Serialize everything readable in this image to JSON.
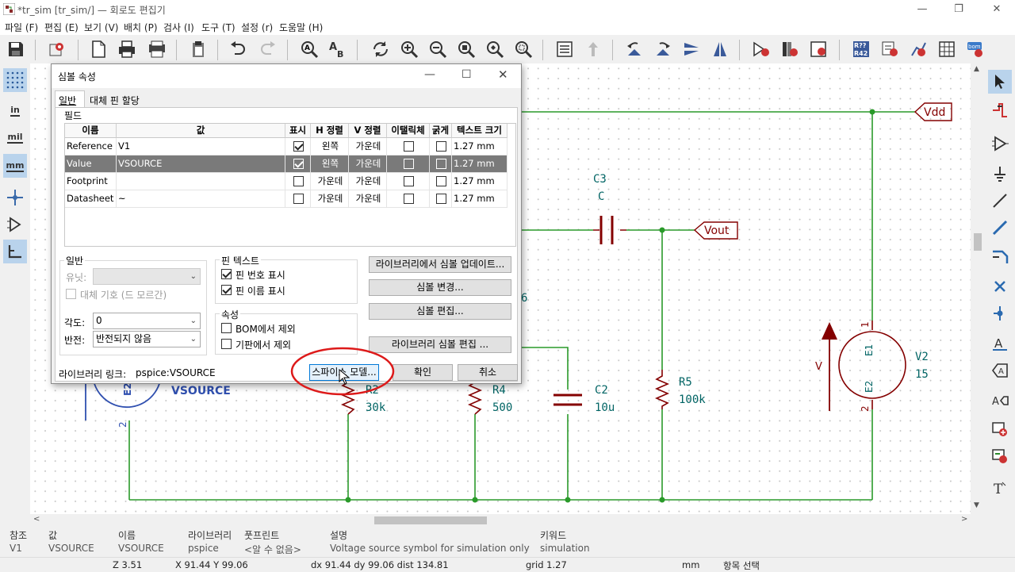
{
  "window": {
    "title": "*tr_sim [tr_sim/] — 회로도 편집기"
  },
  "menu": [
    "파일 (F)",
    "편집 (E)",
    "보기 (V)",
    "배치 (P)",
    "검사 (I)",
    "도구 (T)",
    "설정 (r)",
    "도움말 (H)"
  ],
  "left_toolbar": {
    "units_in": "in",
    "units_mil": "mil",
    "units_mm": "mm"
  },
  "schematic": {
    "labels": {
      "vdd": "Vdd",
      "vout": "Vout"
    },
    "c3": {
      "ref": "C3",
      "value": "C"
    },
    "c2": {
      "ref": "C2",
      "value": "10u"
    },
    "r5": {
      "ref": "R5",
      "value": "100k"
    },
    "r4": {
      "ref": "R4",
      "value": "500"
    },
    "r2": {
      "ref": "R2",
      "value": "30k"
    },
    "v2": {
      "ref": "V2",
      "value": "15",
      "pin_top": "E1",
      "pin_bottom": "E2",
      "pin_num_top": "1",
      "pin_num_bottom": "2",
      "arrow_label": "V"
    },
    "v1": {
      "value_text": "VSOURCE",
      "pin": "E2",
      "pin_num": "2"
    },
    "partial_text": "6"
  },
  "dialog": {
    "title": "심볼 속성",
    "tabs": [
      "일반",
      "대체 핀 할당"
    ],
    "fields_label": "필드",
    "columns": [
      "이름",
      "값",
      "표시",
      "H 정렬",
      "V 정렬",
      "이탤릭체",
      "굵게",
      "텍스트 크기"
    ],
    "rows": [
      {
        "name": "Reference",
        "value": "V1",
        "show": true,
        "h": "왼쪽",
        "v": "가운데",
        "italic": false,
        "bold": false,
        "size": "1.27 mm",
        "selected": false
      },
      {
        "name": "Value",
        "value": "VSOURCE",
        "show": true,
        "h": "왼쪽",
        "v": "가운데",
        "italic": false,
        "bold": false,
        "size": "1.27 mm",
        "selected": true
      },
      {
        "name": "Footprint",
        "value": "",
        "show": false,
        "h": "가운데",
        "v": "가운데",
        "italic": false,
        "bold": false,
        "size": "1.27 mm",
        "selected": false
      },
      {
        "name": "Datasheet",
        "value": "~",
        "show": false,
        "h": "가운데",
        "v": "가운데",
        "italic": false,
        "bold": false,
        "size": "1.27 mm",
        "selected": false
      }
    ],
    "general": {
      "label": "일반",
      "unit_label": "유닛:",
      "alt_symbol": "대체 기호 (드 모르간)",
      "angle_label": "각도:",
      "angle_value": "0",
      "mirror_label": "반전:",
      "mirror_value": "반전되지 않음"
    },
    "pin_text": {
      "label": "핀 텍스트",
      "show_pin_numbers": "핀 번호 표시",
      "show_pin_names": "핀 이름 표시"
    },
    "attributes": {
      "label": "속성",
      "exclude_bom": "BOM에서 제외",
      "exclude_board": "기판에서 제외"
    },
    "buttons": {
      "update_from_library": "라이브러리에서 심볼 업데이트...",
      "change_symbol": "심볼 변경...",
      "edit_symbol": "심볼 편집...",
      "edit_library_symbol": "라이브러리 심볼 편집 ...",
      "spice_model": "스파이스 모델...",
      "ok": "확인",
      "cancel": "취소"
    },
    "library_link_label": "라이브러리 링크:",
    "library_link_value": "pspice:VSOURCE"
  },
  "message_panel": [
    {
      "header": "참조",
      "value": "V1"
    },
    {
      "header": "값",
      "value": "VSOURCE"
    },
    {
      "header": "이름",
      "value": "VSOURCE"
    },
    {
      "header": "라이브러리",
      "value": "pspice"
    },
    {
      "header": "풋프린트",
      "value": "<알 수 없음>"
    },
    {
      "header": "설명",
      "value": "Voltage source symbol for simulation only"
    },
    {
      "header": "키워드",
      "value": "simulation"
    }
  ],
  "status": {
    "zoom": "Z 3.51",
    "xy": "X 91.44  Y 99.06",
    "delta": "dx 91.44  dy 99.06  dist 134.81",
    "grid": "grid 1.27",
    "units": "mm",
    "mode": "항목 선택"
  },
  "colors": {
    "wire": "#2a9a2a",
    "component": "#840000",
    "label_text": "#840000",
    "ref_text": "#006464",
    "selected_row": "#7a7a7a",
    "annotation_circle": "#dd1a1a",
    "vsource_text": "#3050b0"
  }
}
